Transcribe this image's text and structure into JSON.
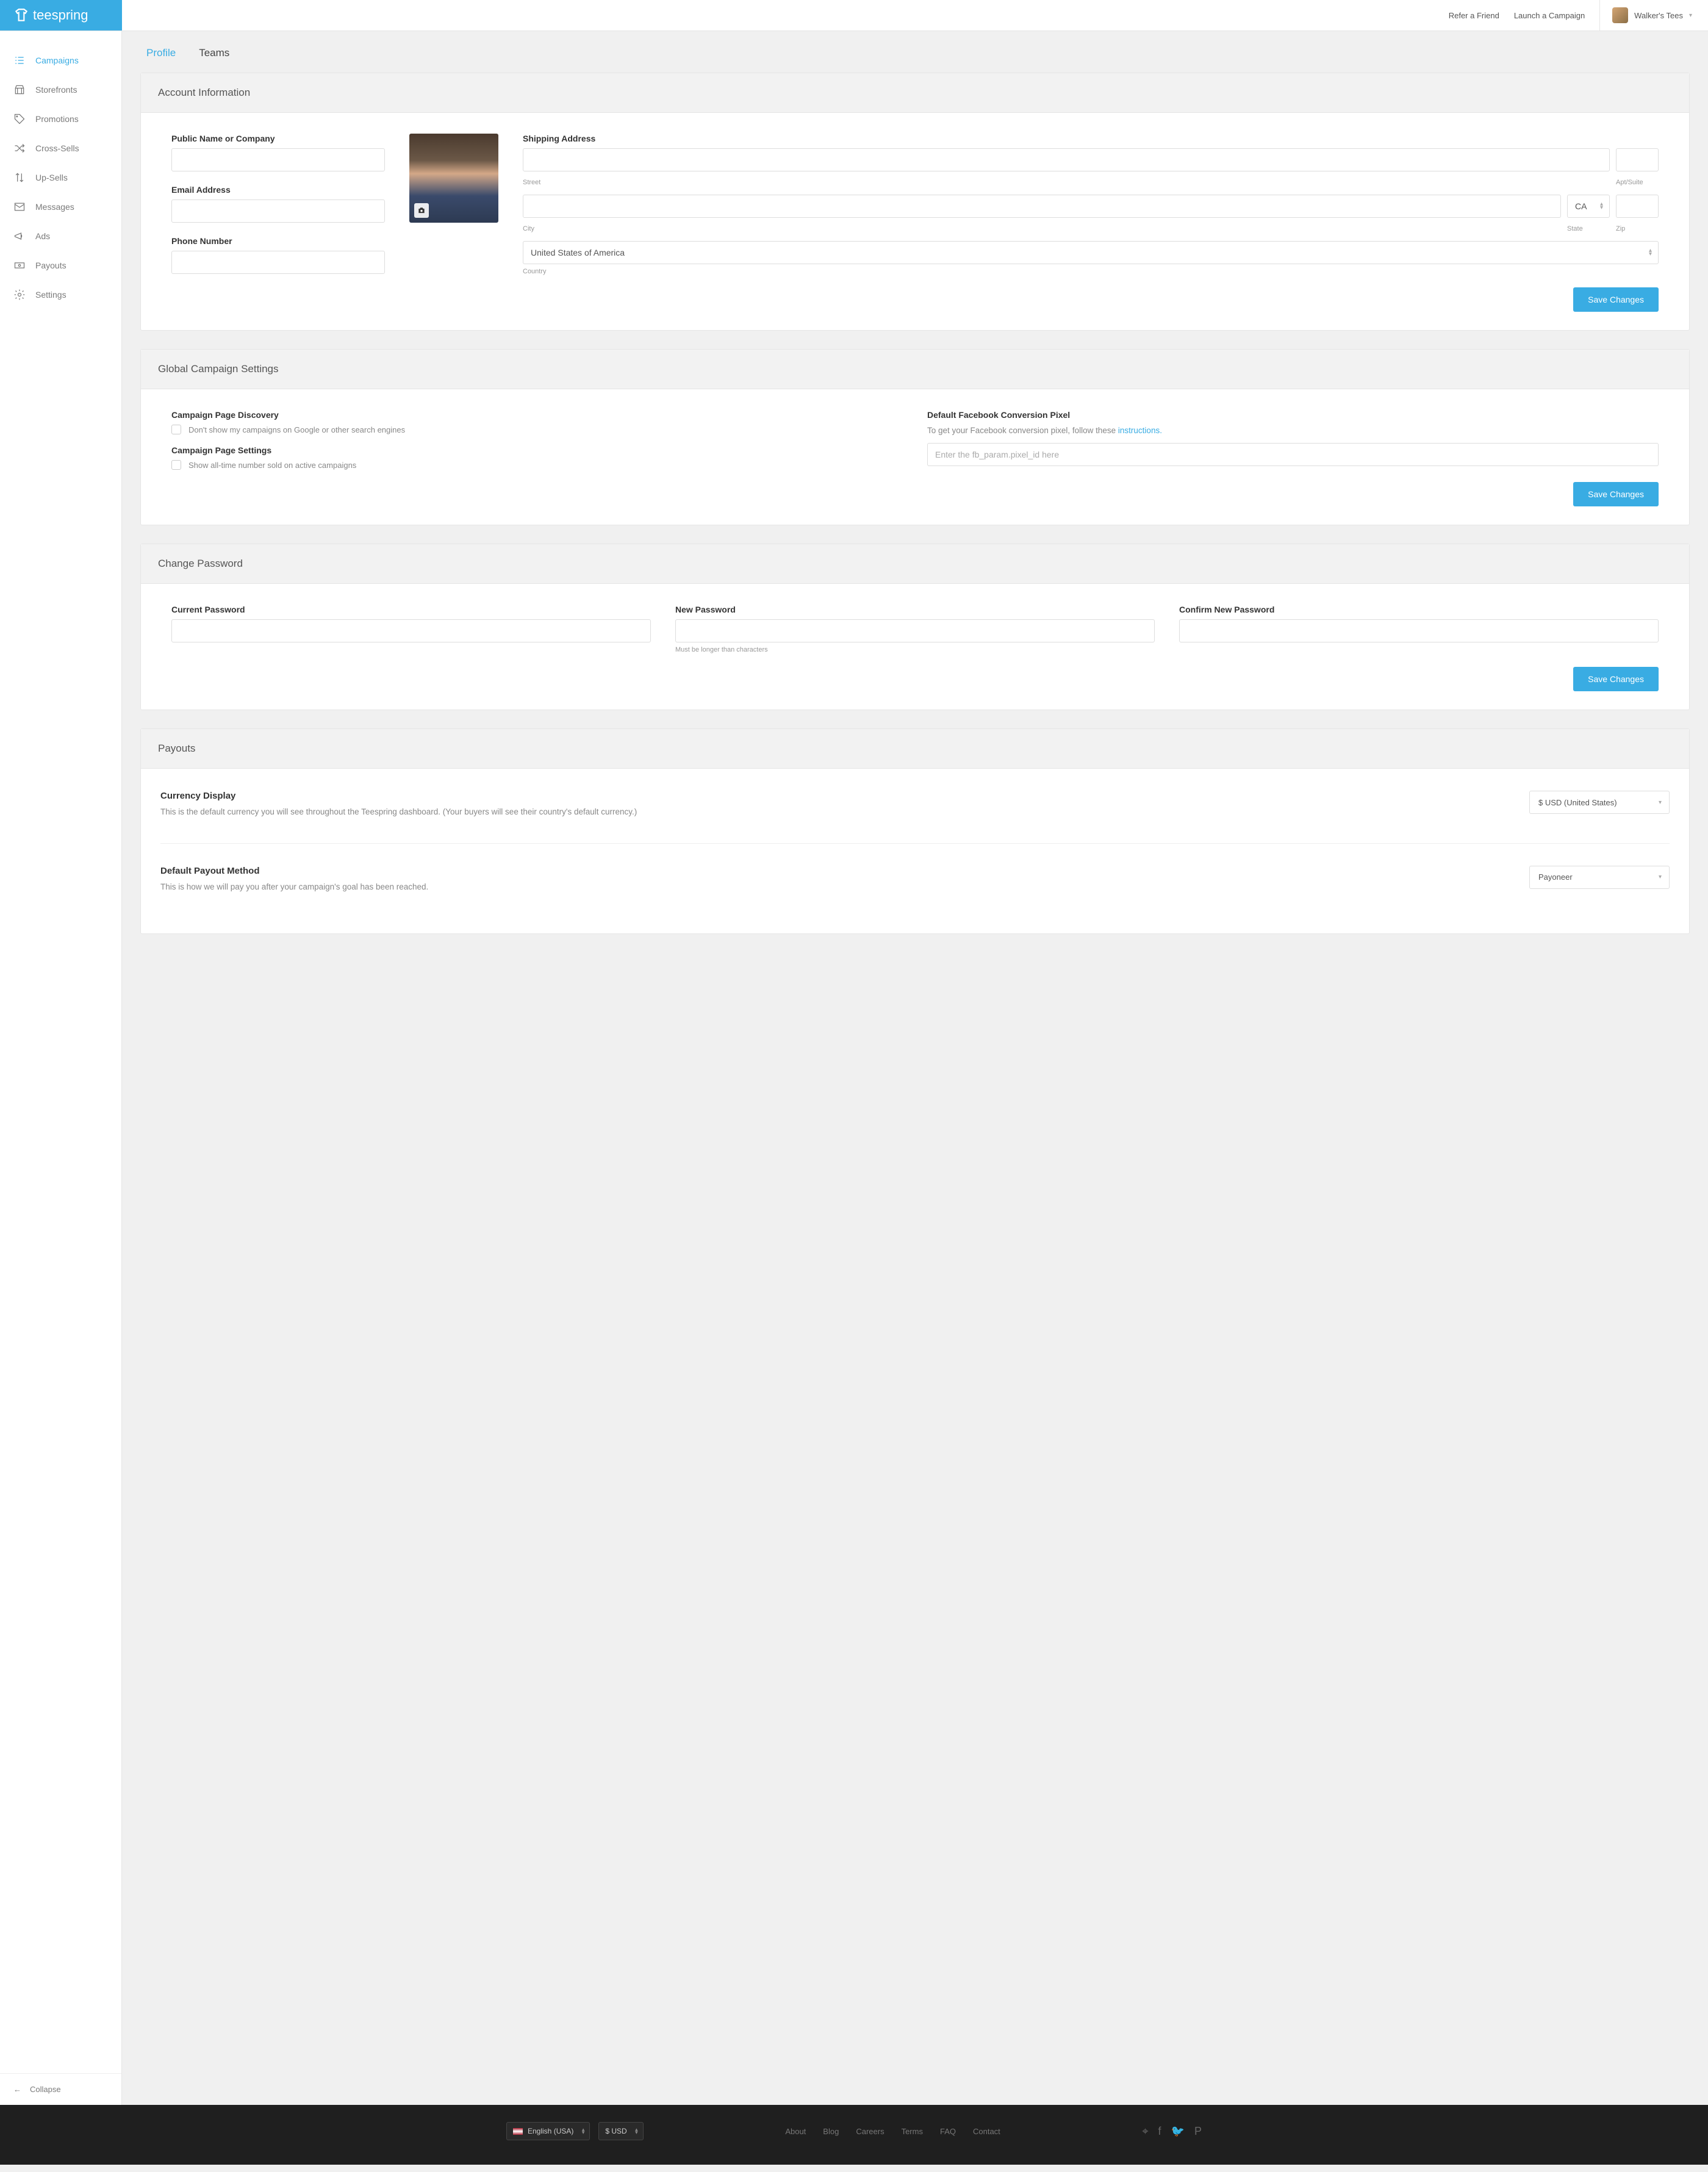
{
  "brand": "teespring",
  "topbar": {
    "refer": "Refer a Friend",
    "launch": "Launch a Campaign",
    "user": "Walker's Tees"
  },
  "sidebar": {
    "items": [
      {
        "label": "Campaigns"
      },
      {
        "label": "Storefronts"
      },
      {
        "label": "Promotions"
      },
      {
        "label": "Cross-Sells"
      },
      {
        "label": "Up-Sells"
      },
      {
        "label": "Messages"
      },
      {
        "label": "Ads"
      },
      {
        "label": "Payouts"
      },
      {
        "label": "Settings"
      }
    ],
    "collapse": "Collapse"
  },
  "tabs": {
    "profile": "Profile",
    "teams": "Teams"
  },
  "account": {
    "title": "Account Information",
    "name_lbl": "Public Name or Company",
    "email_lbl": "Email Address",
    "phone_lbl": "Phone Number",
    "ship_lbl": "Shipping Address",
    "street": "Street",
    "apt": "Apt/Suite",
    "city": "City",
    "state": "State",
    "state_val": "CA",
    "zip": "Zip",
    "country_val": "United States of America",
    "country": "Country",
    "save": "Save Changes"
  },
  "global": {
    "title": "Global Campaign Settings",
    "discovery_lbl": "Campaign Page Discovery",
    "discovery_chk": "Don't show my campaigns on Google or other search engines",
    "settings_lbl": "Campaign Page Settings",
    "settings_chk": "Show all-time number sold on active campaigns",
    "fb_lbl": "Default Facebook Conversion Pixel",
    "fb_desc1": "To get your Facebook conversion pixel, follow these ",
    "fb_link": "instructions.",
    "fb_placeholder": "Enter the fb_param.pixel_id here",
    "save": "Save Changes"
  },
  "password": {
    "title": "Change Password",
    "current": "Current Password",
    "new": "New Password",
    "confirm": "Confirm New Password",
    "hint": "Must be longer than characters",
    "save": "Save Changes"
  },
  "payouts": {
    "title": "Payouts",
    "currency_lbl": "Currency Display",
    "currency_desc": "This is the default currency you will see throughout the Teespring dashboard. (Your buyers will see their country's default currency.)",
    "currency_val": "$ USD (United States)",
    "method_lbl": "Default Payout Method",
    "method_desc": "This is how we will pay you after your campaign's goal has been reached.",
    "method_val": "Payoneer"
  },
  "footer": {
    "lang": "English (USA)",
    "curr": "$ USD",
    "links": [
      "About",
      "Blog",
      "Careers",
      "Terms",
      "FAQ",
      "Contact"
    ]
  }
}
